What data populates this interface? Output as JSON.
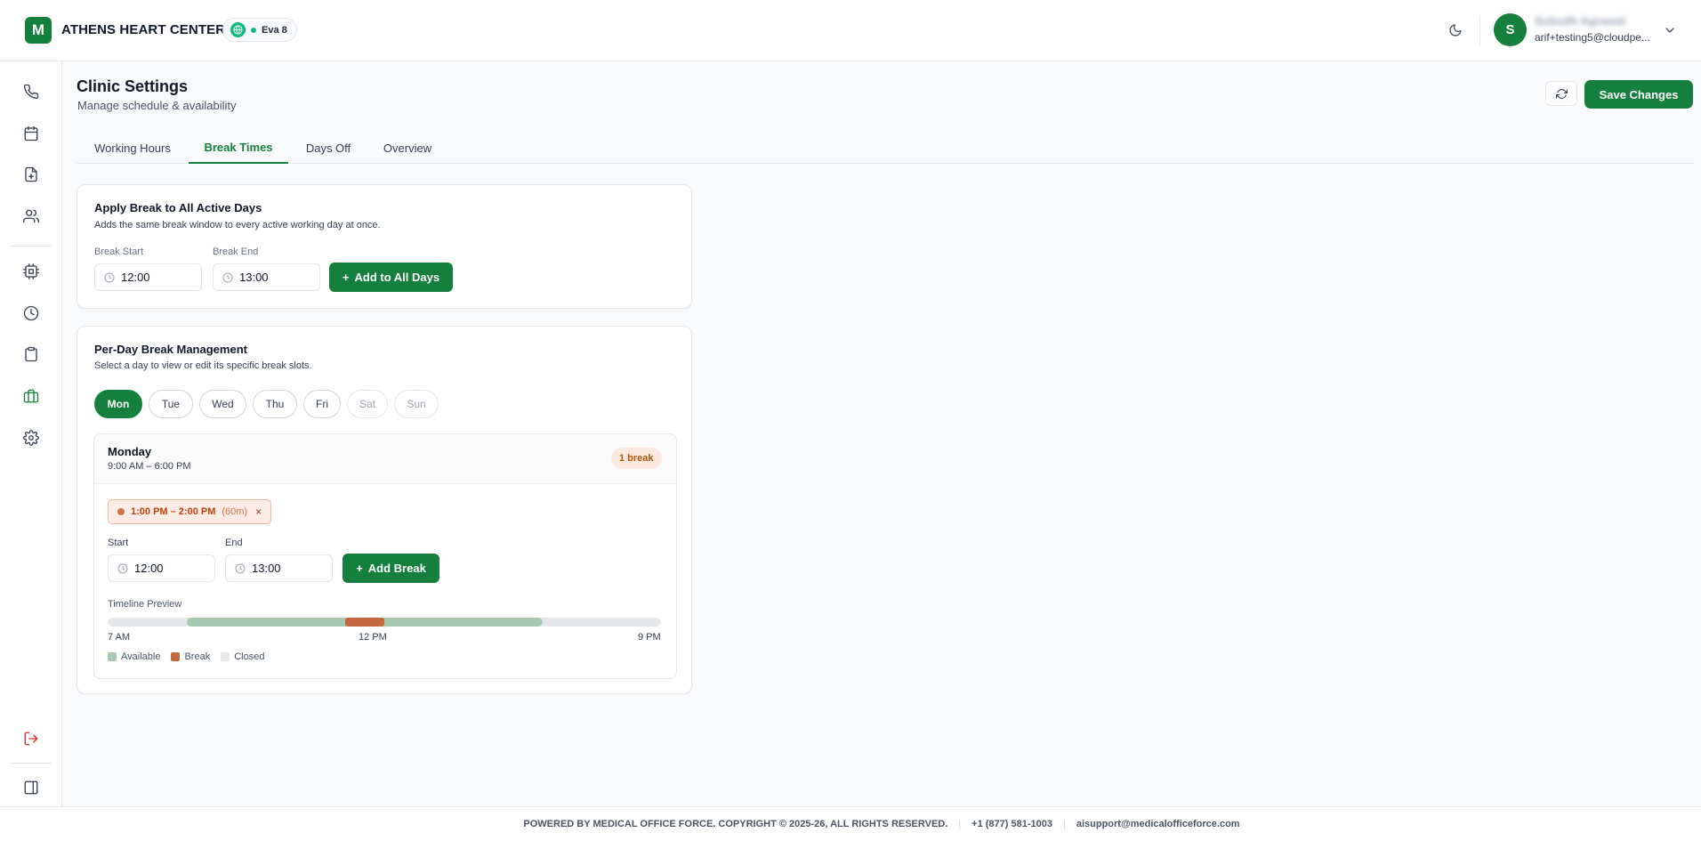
{
  "header": {
    "logo_letter": "M",
    "org_name": "ATHENS HEART CENTER",
    "agent_label": "Eva 8",
    "user_initial": "S",
    "user_name": "Subodh Agrawal",
    "user_email": "arif+testing5@cloudpe..."
  },
  "sidebar": {
    "items": [
      {
        "name": "phone-icon"
      },
      {
        "name": "calendar-icon"
      },
      {
        "name": "file-plus-icon"
      },
      {
        "name": "users-icon"
      },
      {
        "name": "cpu-icon"
      },
      {
        "name": "clock-icon"
      },
      {
        "name": "clipboard-icon"
      },
      {
        "name": "briefcase-icon",
        "active": true
      },
      {
        "name": "gear-icon"
      }
    ],
    "logout_icon": "logout-icon",
    "collapse_icon": "sidebar-toggle-icon"
  },
  "page": {
    "title": "Clinic Settings",
    "subtitle": "Manage schedule & availability",
    "save_label": "Save Changes"
  },
  "tabs": [
    {
      "label": "Working Hours",
      "active": false
    },
    {
      "label": "Break Times",
      "active": true
    },
    {
      "label": "Days Off",
      "active": false
    },
    {
      "label": "Overview",
      "active": false
    }
  ],
  "apply_all": {
    "title": "Apply Break to All Active Days",
    "description": "Adds the same break window to every active working day at once.",
    "start_label": "Break Start",
    "start_value": "12:00",
    "end_label": "Break End",
    "end_value": "13:00",
    "button_label": "Add to All Days"
  },
  "per_day": {
    "title": "Per-Day Break Management",
    "description": "Select a day to view or edit its specific break slots.",
    "days": [
      {
        "label": "Mon",
        "state": "active"
      },
      {
        "label": "Tue",
        "state": "enabled"
      },
      {
        "label": "Wed",
        "state": "enabled"
      },
      {
        "label": "Thu",
        "state": "enabled"
      },
      {
        "label": "Fri",
        "state": "enabled"
      },
      {
        "label": "Sat",
        "state": "inactive"
      },
      {
        "label": "Sun",
        "state": "inactive"
      }
    ],
    "selected_day": {
      "name": "Monday",
      "hours": "9:00 AM – 6:00 PM",
      "badge": "1 break",
      "slots": [
        {
          "time": "1:00 PM – 2:00 PM",
          "duration": "(60m)",
          "remove": "×"
        }
      ],
      "start_label": "Start",
      "start_value": "12:00",
      "end_label": "End",
      "end_value": "13:00",
      "add_label": "Add Break"
    },
    "timeline": {
      "label": "Timeline Preview",
      "range_start_hour": 7,
      "range_end_hour": 21,
      "available": [
        9,
        18
      ],
      "breaks": [
        [
          13,
          14
        ]
      ],
      "ticks": [
        "7 AM",
        "12 PM",
        "9 PM"
      ],
      "legend": [
        {
          "label": "Available",
          "color": "#a7c9b1"
        },
        {
          "label": "Break",
          "color": "#c4683f"
        },
        {
          "label": "Closed",
          "color": "#e5e7eb"
        }
      ]
    }
  },
  "footer": {
    "copyright": "POWERED BY MEDICAL OFFICE FORCE. COPYRIGHT © 2025-26, ALL RIGHTS RESERVED.",
    "phone": "+1 (877) 581-1003",
    "email": "aisupport@medicalofficeforce.com"
  }
}
